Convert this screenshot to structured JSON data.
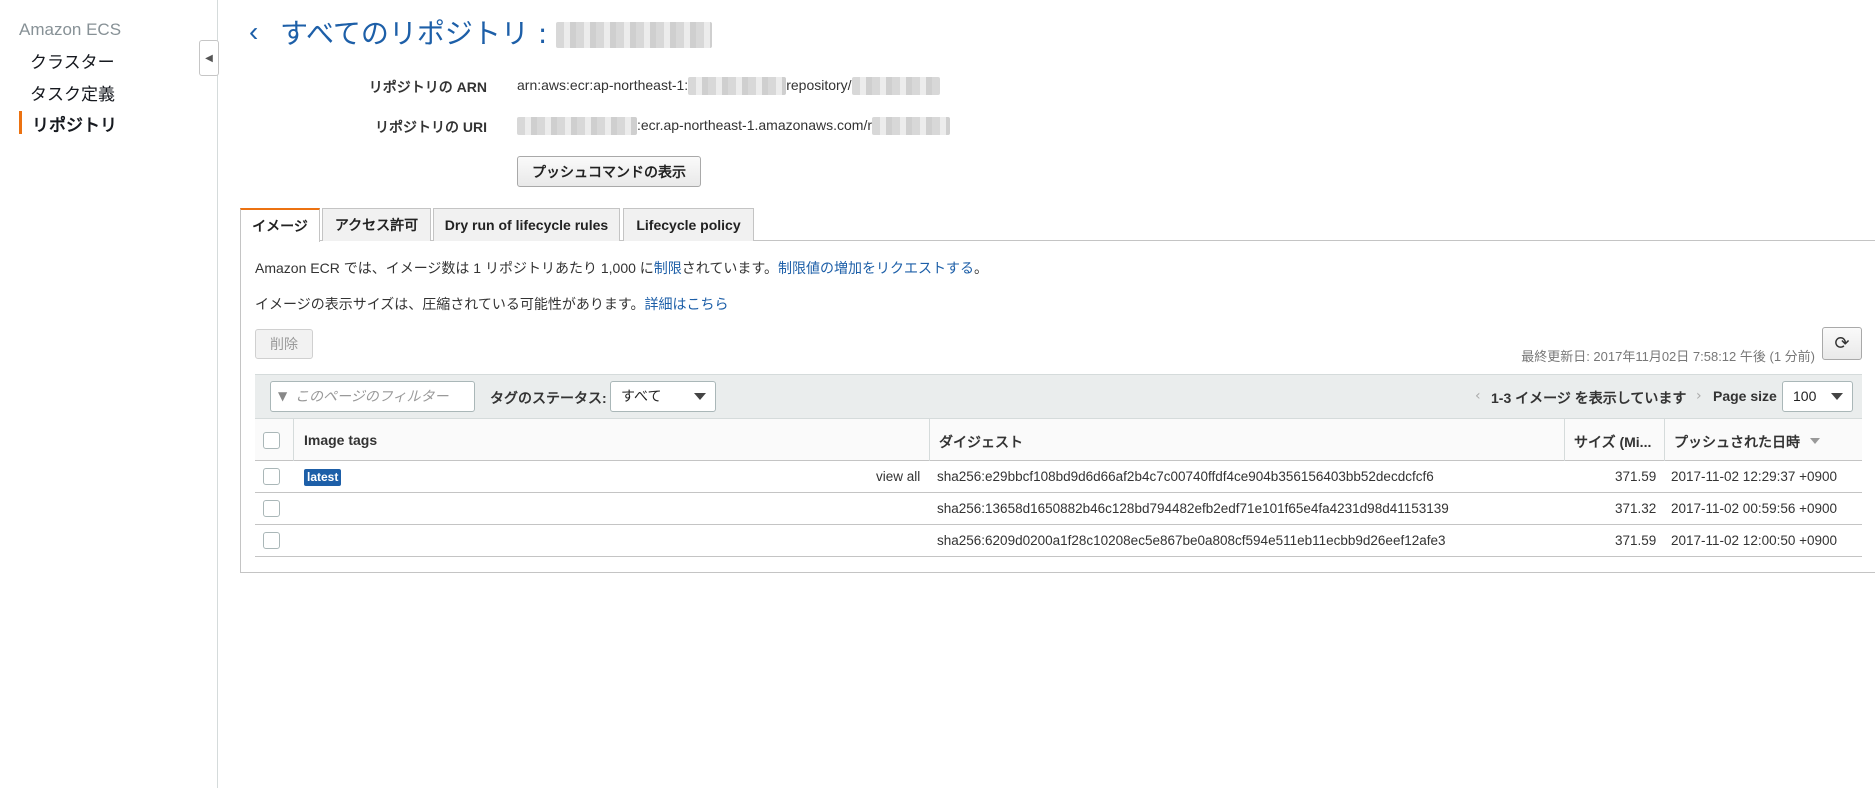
{
  "sidebar": {
    "title": "Amazon ECS",
    "items": [
      {
        "label": "クラスター"
      },
      {
        "label": "タスク定義"
      },
      {
        "label": "リポジトリ"
      }
    ]
  },
  "header": {
    "title": "すべてのリポジトリ :"
  },
  "repo": {
    "arn_label": "リポジトリの ARN",
    "arn_prefix": "arn:aws:ecr:ap-northeast-1:",
    "arn_middle": "repository/",
    "uri_label": "リポジトリの URI",
    "uri_middle": ":ecr.ap-northeast-1.amazonaws.com/r",
    "push_button": "プッシュコマンドの表示"
  },
  "tabs": [
    {
      "label": "イメージ"
    },
    {
      "label": "アクセス許可"
    },
    {
      "label": "Dry run of lifecycle rules"
    },
    {
      "label": "Lifecycle policy"
    }
  ],
  "info": {
    "line1_a": "Amazon ECR では、イメージ数は 1 リポジトリあたり 1,000 に",
    "line1_link1": "制限",
    "line1_b": "されています。",
    "line1_link2": "制限値の増加をリクエストする",
    "line1_c": "。",
    "line2_a": "イメージの表示サイズは、圧縮されている可能性があります。",
    "line2_link": "詳細はこちら"
  },
  "actions": {
    "delete_button": "削除",
    "last_updated": "最終更新日: 2017年11月02日 7:58:12 午後 (1 分前)"
  },
  "toolbar": {
    "filter_placeholder": "このページのフィルター",
    "tag_status_label": "タグのステータス:",
    "tag_status_value": "すべて",
    "pager_text": "1-3 イメージ を表示しています",
    "page_size_label": "Page size",
    "page_size_value": "100"
  },
  "table": {
    "columns": [
      "Image tags",
      "ダイジェスト",
      "サイズ (Mi...",
      "プッシュされた日時"
    ],
    "rows": [
      {
        "tag": "latest",
        "view_all": "view all",
        "digest": "sha256:e29bbcf108bd9d6d66af2b4c7c00740ffdf4ce904b356156403bb52decdcfcf6",
        "size": "371.59",
        "pushed": "2017-11-02 12:29:37 +0900"
      },
      {
        "tag": "",
        "view_all": "",
        "digest": "sha256:13658d1650882b46c128bd794482efb2edf71e101f65e4fa4231d98d41153139",
        "size": "371.32",
        "pushed": "2017-11-02 00:59:56 +0900"
      },
      {
        "tag": "",
        "view_all": "",
        "digest": "sha256:6209d0200a1f28c10208ec5e867be0a808cf594e511eb11ecbb9d26eef12afe3",
        "size": "371.59",
        "pushed": "2017-11-02 12:00:50 +0900"
      }
    ]
  },
  "colors": {
    "accent": "#ec7211",
    "link": "#1d5fa8"
  }
}
